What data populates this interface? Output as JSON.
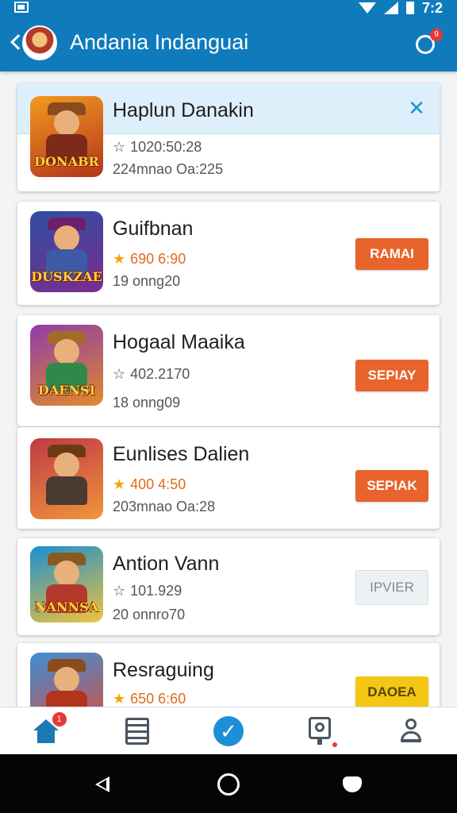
{
  "status_bar": {
    "time": "7:2"
  },
  "app_bar": {
    "title": "Andania Indanguai",
    "notification_count": "9",
    "icons": [
      "back-chevron-icon",
      "avatar",
      "notification-icon"
    ]
  },
  "games": [
    {
      "title": "Haplun Danakin",
      "meta1": "1020:50:28",
      "meta2": "224mnao Oa:225",
      "thumb_caption": "DONABR",
      "rated": false,
      "highlight": true,
      "action": "",
      "close_symbol": "✕",
      "thumb_colors": [
        "#f29a1f",
        "#b3341c"
      ]
    },
    {
      "title": "Guifbnan",
      "meta1": "690 6:90",
      "meta2": "19 onng20",
      "thumb_caption": "DUSKZAE",
      "rated": true,
      "action": "RAMAI",
      "action_style": "orange",
      "thumb_colors": [
        "#2f4fa0",
        "#7b2c8e"
      ]
    },
    {
      "title": "Hogaal Maaika",
      "meta1": "402.2170",
      "meta2": "18 onng09",
      "thumb_caption": "DAENSI",
      "rated": false,
      "action": "SEPIAY",
      "action_style": "orange",
      "thumb_colors": [
        "#8f3da8",
        "#e08a2a"
      ]
    },
    {
      "title": "Eunlises Dalien",
      "meta1": "400 4:50",
      "meta2": "203mnao Oa:28",
      "thumb_caption": "",
      "rated": true,
      "action": "SEPIAK",
      "action_style": "orange",
      "thumb_colors": [
        "#c03a45",
        "#f0953a"
      ]
    },
    {
      "title": "Antion Vann",
      "meta1": "101.929",
      "meta2": "20 onnro70",
      "thumb_caption": "NANNSA",
      "rated": false,
      "action": "IPVIER",
      "action_style": "light",
      "thumb_colors": [
        "#1b8fd0",
        "#f2c33b"
      ]
    },
    {
      "title": "Resraguing",
      "meta1": "650 6:60",
      "meta2": "",
      "thumb_caption": "",
      "rated": true,
      "action": "DAOEA",
      "action_style": "yellow",
      "thumb_colors": [
        "#3a8fd6",
        "#e24b3a"
      ]
    }
  ],
  "bottom_nav": {
    "home_badge": "1",
    "items": [
      "home-icon",
      "list-icon",
      "check-icon",
      "badge-icon",
      "profile-icon"
    ],
    "check_symbol": "✓"
  },
  "colors": {
    "primary": "#0f7bbd",
    "action_orange": "#e8642c",
    "action_yellow": "#f3c713",
    "star": "#f4a400"
  }
}
